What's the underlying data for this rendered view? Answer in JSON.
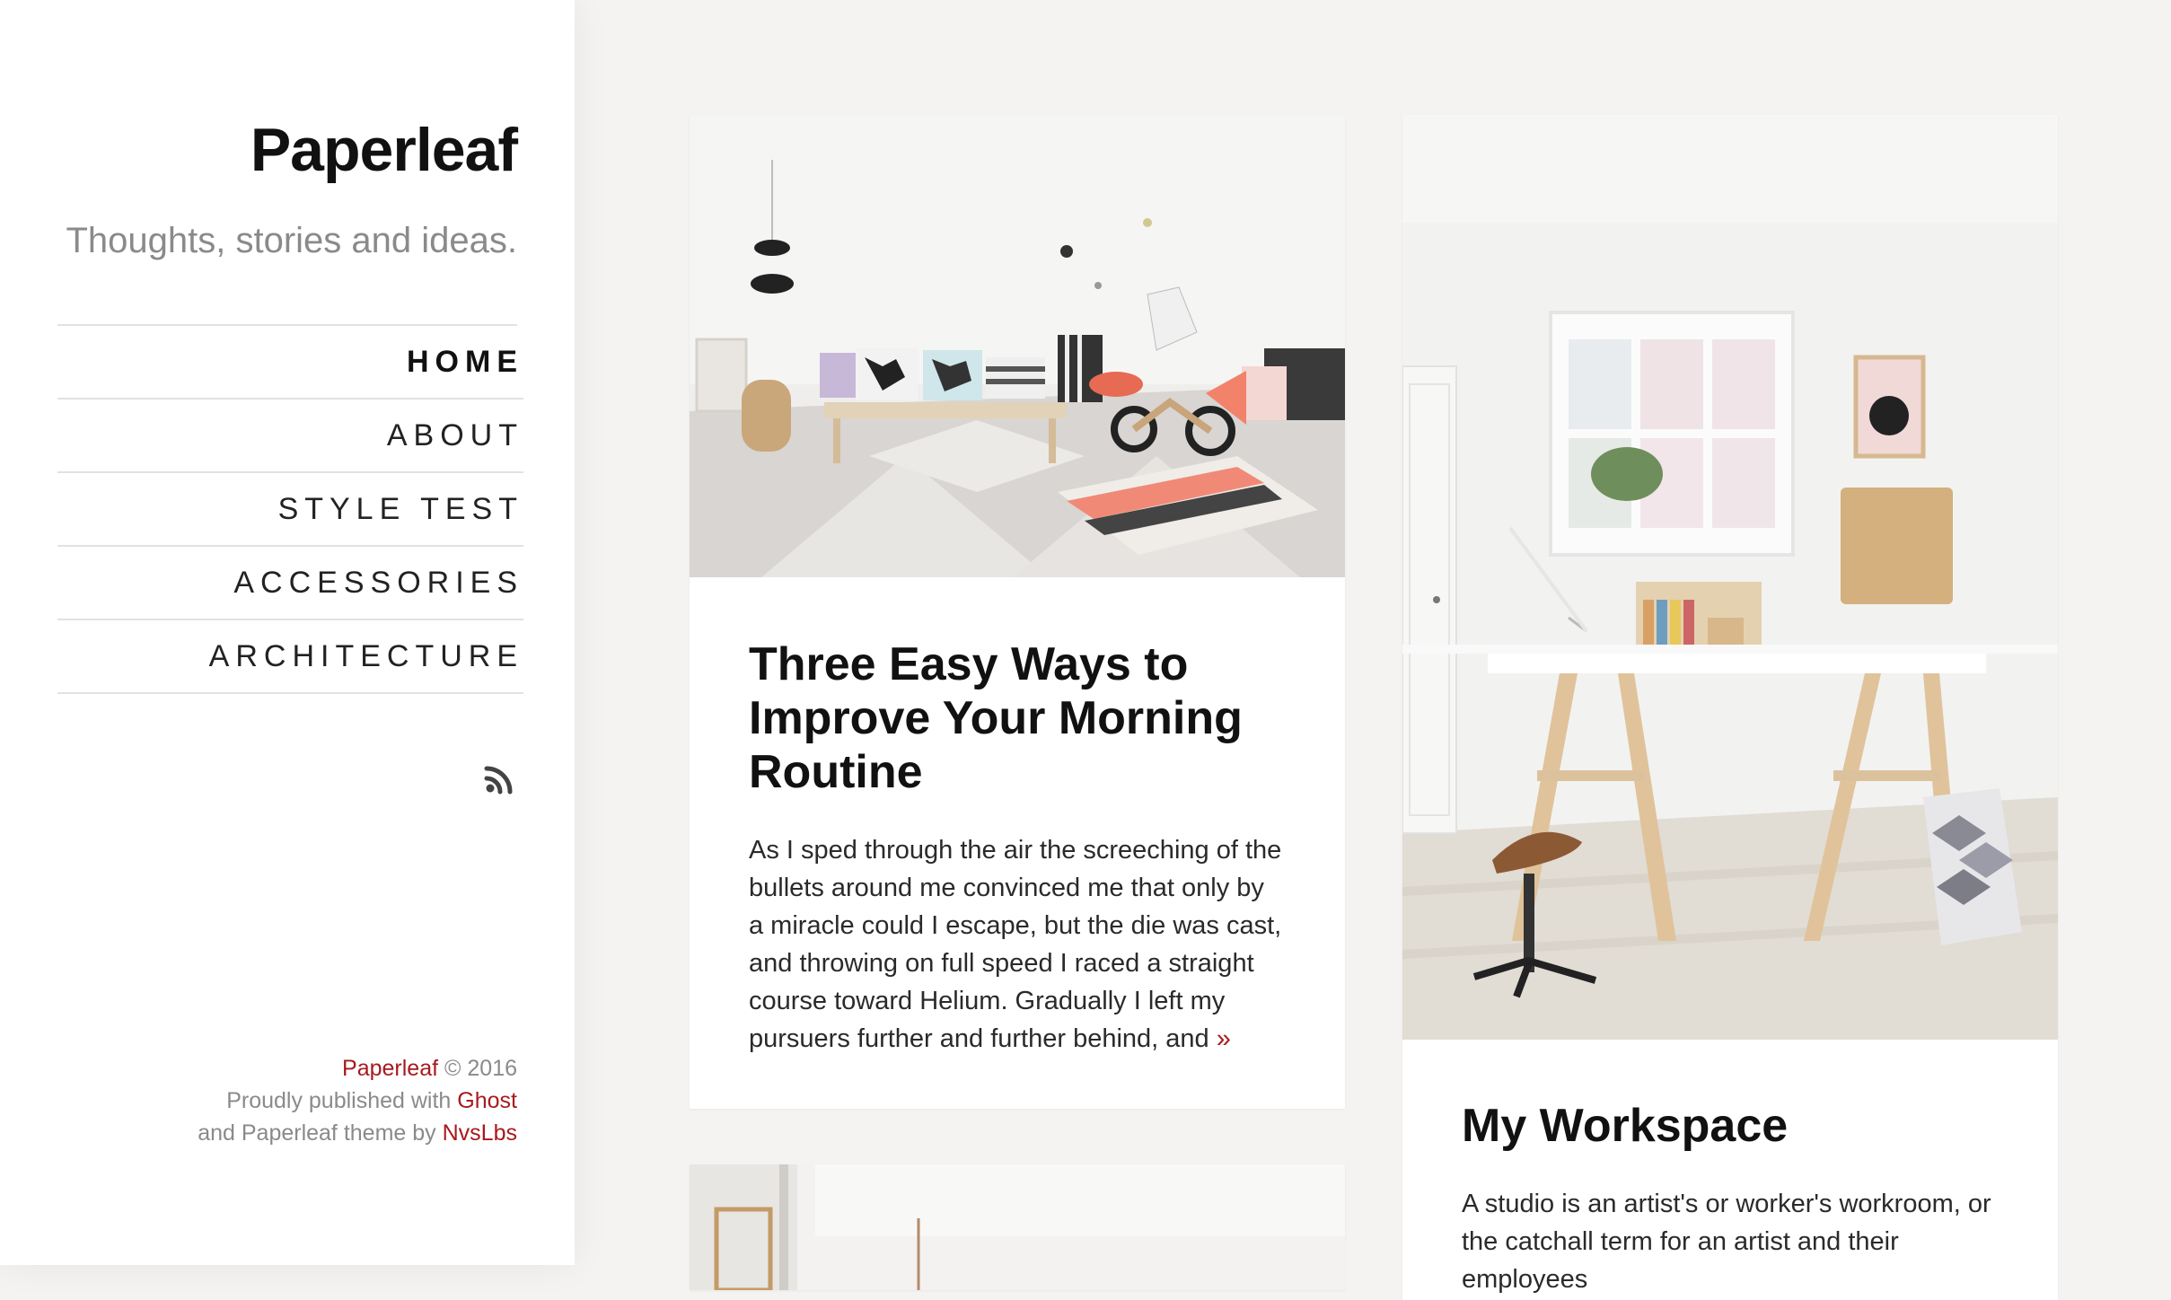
{
  "site": {
    "title": "Paperleaf",
    "description": "Thoughts, stories and ideas."
  },
  "nav": [
    {
      "label": "HOME",
      "active": true
    },
    {
      "label": "ABOUT"
    },
    {
      "label": "STYLE TEST"
    },
    {
      "label": "ACCESSORIES"
    },
    {
      "label": "ARCHITECTURE"
    }
  ],
  "footer": {
    "brand": "Paperleaf",
    "copyright": "© 2016",
    "published_text": "Proudly published with",
    "ghost_link": "Ghost",
    "theme_text": "and Paperleaf theme by",
    "author_link": "NvsLbs"
  },
  "posts": [
    {
      "title": "Three Easy Ways to Improve Your Morning Routine",
      "excerpt": "As I sped through the air the screeching of the bullets around me convinced me that only by a miracle could I escape, but the die was cast, and throwing on full speed I raced a straight course toward Helium. Gradually I left my pursuers further and further behind, and",
      "more": "»"
    },
    {
      "title": "My Workspace",
      "excerpt": "A studio is an artist's or worker's workroom, or the catchall term for an artist and their employees"
    }
  ],
  "colors": {
    "accent": "#a8191d",
    "background": "#f4f3f2",
    "sidebar": "#ffffff"
  },
  "icons": {
    "rss": "rss-icon"
  }
}
